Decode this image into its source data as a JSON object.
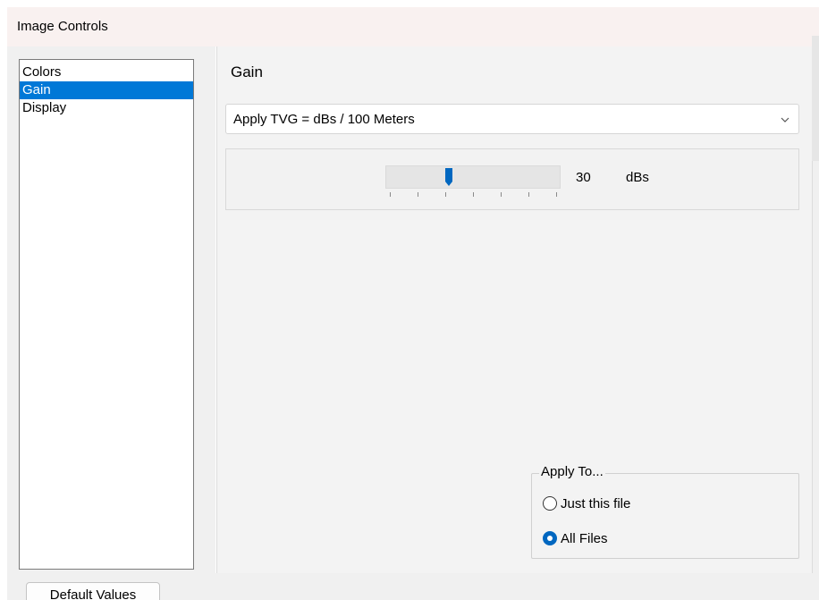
{
  "window": {
    "title": "Image Controls"
  },
  "nav": {
    "items": [
      {
        "label": "Colors",
        "selected": false
      },
      {
        "label": "Gain",
        "selected": true
      },
      {
        "label": "Display",
        "selected": false
      }
    ]
  },
  "panel": {
    "title": "Gain",
    "tvg_select": {
      "value": "Apply TVG = dBs / 100 Meters"
    },
    "slider": {
      "value": "30",
      "unit": "dBs",
      "position_fraction": 0.36
    },
    "apply_to": {
      "legend": "Apply To...",
      "options": [
        {
          "label": "Just this file",
          "checked": false
        },
        {
          "label": "All Files",
          "checked": true
        }
      ]
    }
  },
  "footer": {
    "default_button": "Default Values"
  },
  "colors": {
    "accent": "#0078d7",
    "radio_accent": "#0067c0",
    "thumb": "#0067c0"
  }
}
